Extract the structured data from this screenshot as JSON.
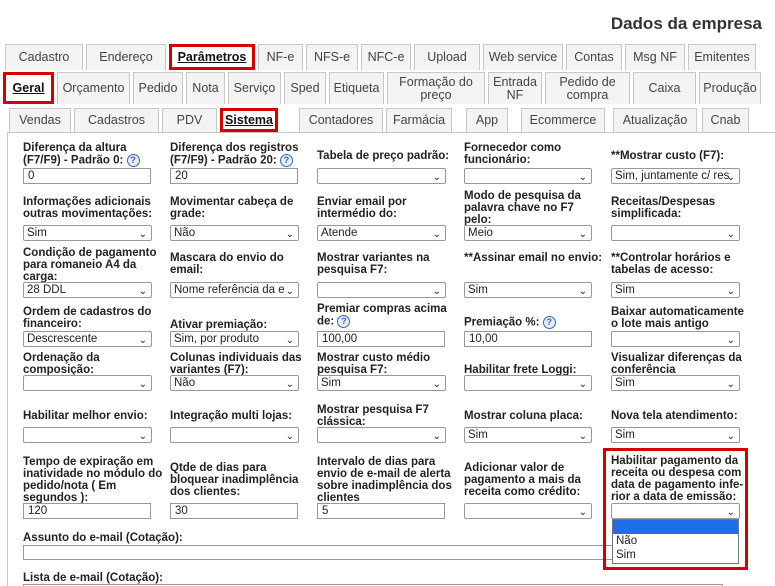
{
  "page_title": "Dados da empresa",
  "tabs_row1": [
    "Cadastro",
    "Endereço",
    "Parâmetros",
    "NF-e",
    "NFS-e",
    "NFC-e",
    "Upload",
    "Web service",
    "Contas",
    "Msg NF",
    "Emitentes"
  ],
  "tabs_row2": [
    "Geral",
    "Orçamento",
    "Pedido",
    "Nota",
    "Serviço",
    "Sped",
    "Etiqueta",
    "Formação do preço",
    "Entrada NF",
    "Pedido de compra",
    "Caixa",
    "Produção"
  ],
  "tabs_row3": [
    "Vendas",
    "Cadastros",
    "PDV",
    "Sistema",
    "Contadores",
    "Farmácia",
    "App",
    "Ecommerce",
    "Atualização",
    "Cnab"
  ],
  "help_glyph": "?",
  "arrow_glyph": "⌄",
  "fields": {
    "f1": {
      "label": "Diferença da altura (F7/F9) - Padrão 0:",
      "value": "0"
    },
    "f2": {
      "label": "Diferença dos registros (F7/F9) - Padrão 20:",
      "value": "20"
    },
    "f3": {
      "label": "Tabela de preço padrão:",
      "value": ""
    },
    "f4": {
      "label": "Fornecedor como funcionário:",
      "value": ""
    },
    "f5": {
      "label": "**Mostrar custo (F7):",
      "value": "Sim, juntamente c/ res"
    },
    "f6": {
      "label": "Informações adicionais outras movimentações:",
      "value": "Sim"
    },
    "f7": {
      "label": "Movimentar cabeça de grade:",
      "value": "Não"
    },
    "f8": {
      "label": "Enviar email por intermédio do:",
      "value": "Atende"
    },
    "f9": {
      "label": "Modo de pesquisa da palavra chave no F7 pelo:",
      "value": "Meio"
    },
    "f10": {
      "label": "Receitas/Despesas simplificada:",
      "value": ""
    },
    "f11": {
      "label": "Condição de pagamento para romaneio A4 da carga:",
      "value": "28 DDL"
    },
    "f12": {
      "label": "Mascara do envio do email:",
      "value": "Nome referência da e"
    },
    "f13": {
      "label": "Mostrar variantes na pesquisa F7:",
      "value": ""
    },
    "f14": {
      "label": "**Assinar email no envio:",
      "value": "Sim"
    },
    "f15": {
      "label": "**Controlar horários e tabelas de acesso:",
      "value": "Sim"
    },
    "f16": {
      "label": "Ordem de cadastros do financeiro:",
      "value": "Descrescente"
    },
    "f17": {
      "label": "Ativar premiação:",
      "value": "Sim, por produto"
    },
    "f18": {
      "label": "Premiar compras acima de:",
      "value": "100,00"
    },
    "f19": {
      "label": "Premiação %:",
      "value": "10,00"
    },
    "f20": {
      "label": "Baixar automaticamente o lote mais antigo",
      "value": ""
    },
    "f21": {
      "label": "Ordenação da composição:",
      "value": ""
    },
    "f22": {
      "label": "Colunas individuais das variantes (F7):",
      "value": "Não"
    },
    "f23": {
      "label": "Mostrar custo médio pesquisa F7:",
      "value": "Sim"
    },
    "f24": {
      "label": "Habilitar frete Loggi:",
      "value": ""
    },
    "f25": {
      "label": "Visualizar diferenças da conferência",
      "value": "Sim"
    },
    "f26": {
      "label": "Habilitar melhor envio:",
      "value": ""
    },
    "f27": {
      "label": "Integração multi lojas:",
      "value": ""
    },
    "f28": {
      "label": "Mostrar pesquisa F7 clássica:",
      "value": ""
    },
    "f29": {
      "label": "Mostrar coluna placa:",
      "value": "Sim"
    },
    "f30": {
      "label": "Nova tela atendimento:",
      "value": "Sim"
    },
    "f31": {
      "label": "Tempo de expiração em inatividade no módulo do pedido/nota ( Em segundos ):",
      "value": "120"
    },
    "f32": {
      "label": "Qtde de dias para bloquear inadimplência dos clientes:",
      "value": "30"
    },
    "f33": {
      "label": "Intervalo de dias para envio de e-mail de alerta sobre inadimplência dos clientes",
      "value": "5"
    },
    "f34": {
      "label": "Adicionar valor de pagamento a mais da receita como crédito:",
      "value": ""
    },
    "f35": {
      "label": "Habilitar pagamento da receita ou despesa com data de pagamento infe- rior a data de emissão:",
      "value": ""
    },
    "f36": {
      "label": "Assunto do e-mail (Cotação):",
      "value": ""
    },
    "f37": {
      "label": "Lista de e-mail (Cotação):",
      "value": ""
    }
  },
  "dropdown_options": [
    "",
    "Não",
    "Sim"
  ]
}
